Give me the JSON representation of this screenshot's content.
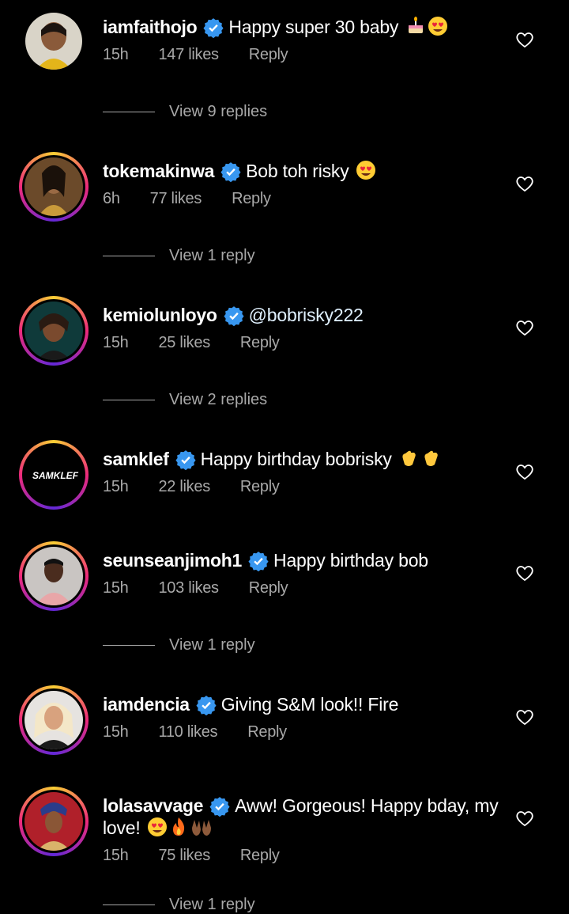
{
  "comments": [
    {
      "user": "iamfaithojo",
      "text": "Happy super 30 baby",
      "time": "15h",
      "likes": "147 likes",
      "reply": "Reply",
      "view": "View 9 replies"
    },
    {
      "user": "tokemakinwa",
      "text": "Bob toh risky",
      "time": "6h",
      "likes": "77 likes",
      "reply": "Reply",
      "view": "View 1 reply"
    },
    {
      "user": "kemiolunloyo",
      "text": "@bobrisky222",
      "time": "15h",
      "likes": "25 likes",
      "reply": "Reply",
      "view": "View 2 replies"
    },
    {
      "user": "samklef",
      "text": "Happy birthday bobrisky",
      "time": "15h",
      "likes": "22 likes",
      "reply": "Reply",
      "avatar_text": "SAMKLEF"
    },
    {
      "user": "seunseanjimoh1",
      "text": "Happy birthday bob",
      "time": "15h",
      "likes": "103 likes",
      "reply": "Reply",
      "view": "View 1 reply"
    },
    {
      "user": "iamdencia",
      "text": "Giving S&M look!! Fire",
      "time": "15h",
      "likes": "110 likes",
      "reply": "Reply"
    },
    {
      "user": "lolasavvage",
      "text": "Aww! Gorgeous! Happy bday, my love!",
      "time": "15h",
      "likes": "75 likes",
      "reply": "Reply",
      "view": "View 1 reply"
    }
  ],
  "colors": {
    "verified": "#3897f0",
    "muted": "#a8a8a8",
    "background": "#000000"
  }
}
